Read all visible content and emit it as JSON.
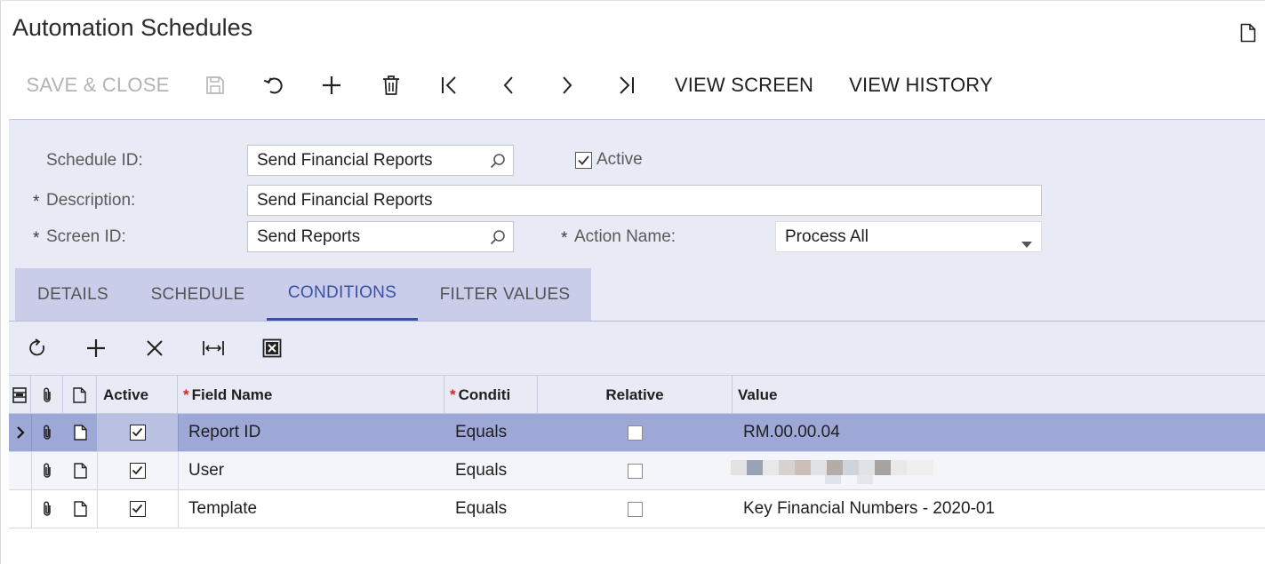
{
  "page": {
    "title": "Automation Schedules"
  },
  "toolbar": {
    "save_close": "SAVE & CLOSE",
    "view_screen": "VIEW SCREEN",
    "view_history": "VIEW HISTORY"
  },
  "form": {
    "schedule_id_label": "Schedule ID:",
    "schedule_id_value": "Send Financial Reports",
    "active_label": "Active",
    "active_checked": true,
    "description_label": "Description:",
    "description_value": "Send Financial Reports",
    "screen_id_label": "Screen ID:",
    "screen_id_value": "Send Reports",
    "action_name_label": "Action Name:",
    "action_name_value": "Process All",
    "required_mark": "*"
  },
  "tabs": [
    {
      "label": "DETAILS",
      "active": false
    },
    {
      "label": "SCHEDULE",
      "active": false
    },
    {
      "label": "CONDITIONS",
      "active": true
    },
    {
      "label": "FILTER VALUES",
      "active": false
    }
  ],
  "grid": {
    "columns": {
      "active": "Active",
      "field_name": "Field Name",
      "condition": "Conditi",
      "relative": "Relative",
      "value": "Value"
    },
    "required_mark": "*",
    "rows": [
      {
        "active": true,
        "field_name": "Report ID",
        "condition": "Equals",
        "relative": false,
        "value": "RM.00.00.04",
        "selected": true
      },
      {
        "active": true,
        "field_name": "User",
        "condition": "Equals",
        "relative": false,
        "value": "",
        "selected": false
      },
      {
        "active": true,
        "field_name": "Template",
        "condition": "Equals",
        "relative": false,
        "value": "Key Financial Numbers - 2020-01",
        "selected": false
      }
    ]
  },
  "colors": {
    "form_bg": "#e8eaf5",
    "tab_strip_bg": "#c9cde9",
    "active_tab": "#3b4fa6",
    "selected_row": "#9ea8d6",
    "required_star": "#d9262a"
  }
}
